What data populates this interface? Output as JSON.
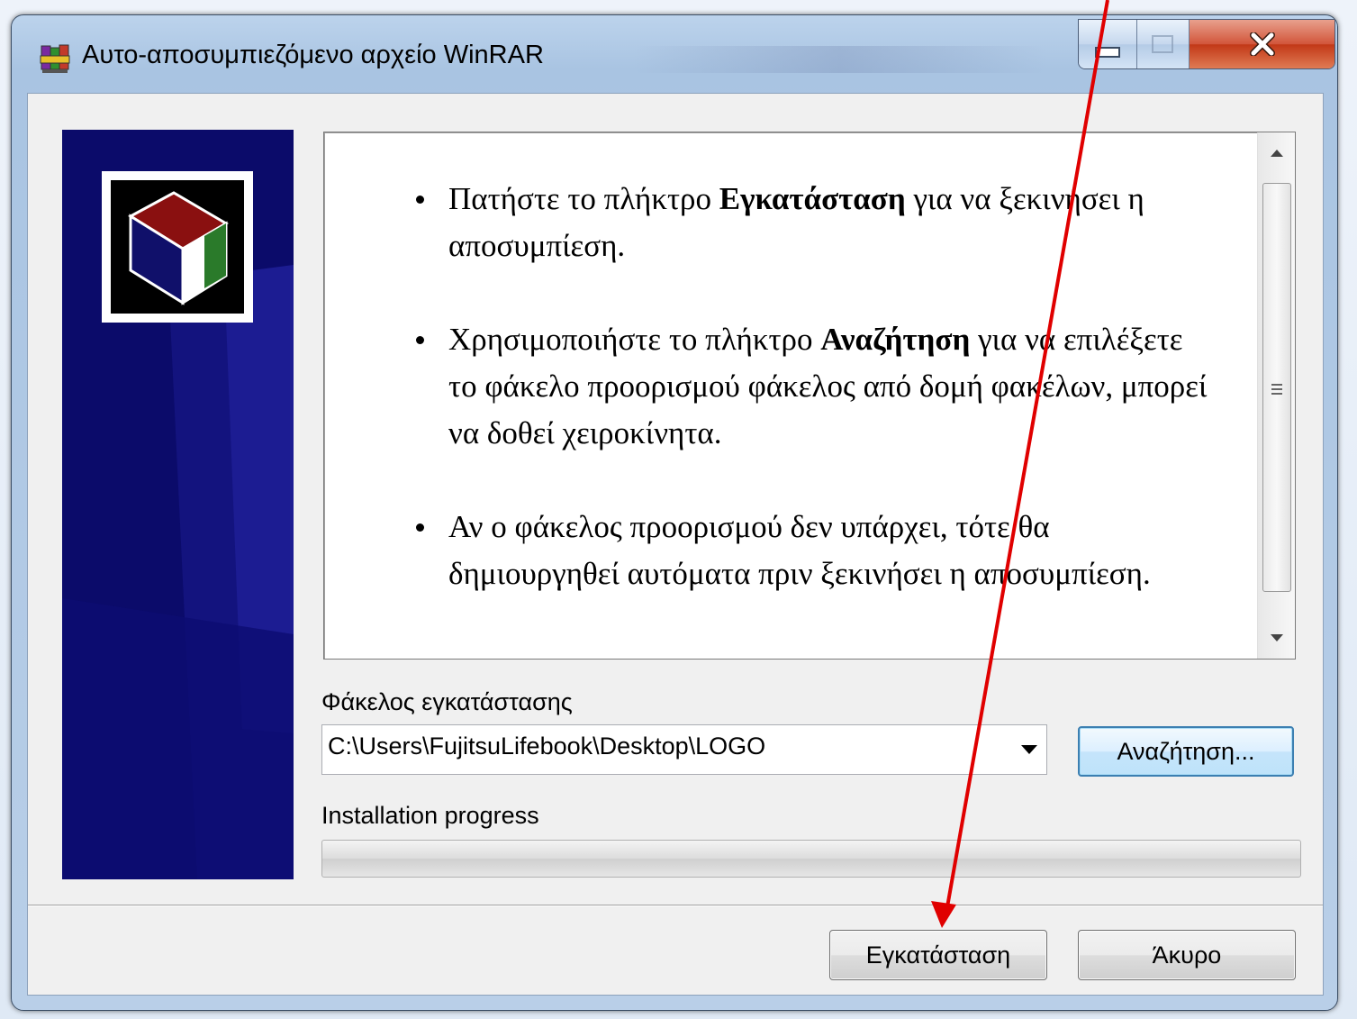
{
  "window": {
    "title": "Αυτο-αποσυμπιεζόμενο αρχείο WinRAR"
  },
  "instructions": {
    "items": [
      {
        "before": "Πατήστε το πλήκτρο ",
        "bold": "Εγκατάσταση",
        "after": " για να ξεκινήσει η αποσυμπίεση."
      },
      {
        "before": "Χρησιμοποιήστε το πλήκτρο ",
        "bold": "Αναζήτηση",
        "after": " για να επιλέξετε το φάκελο προορισμού φάκελος από δομή φακέλων, μπορεί να δοθεί χειροκίνητα."
      },
      {
        "before": "Αν ο φάκελος προορισμού δεν υπάρχει, τότε θα δημιουργηθεί αυτόματα πριν ξεκινήσει η αποσυμπίεση.",
        "bold": "",
        "after": ""
      }
    ]
  },
  "destination": {
    "label": "Φάκελος εγκατάστασης",
    "value": "C:\\Users\\FujitsuLifebook\\Desktop\\LOGO",
    "browse_label": "Αναζήτηση..."
  },
  "progress": {
    "label": "Installation progress",
    "percent": 0
  },
  "buttons": {
    "install_label": "Εγκατάσταση",
    "cancel_label": "Άκυρο"
  },
  "colors": {
    "annotation_arrow": "#e00000",
    "left_panel": "#0b0b6a",
    "close_button": "#c8472a"
  },
  "icons": {
    "app": "winrar-books-icon",
    "minimize": "minimize-icon",
    "maximize": "maximize-icon",
    "close": "close-icon",
    "logo": "archive-box-icon"
  }
}
